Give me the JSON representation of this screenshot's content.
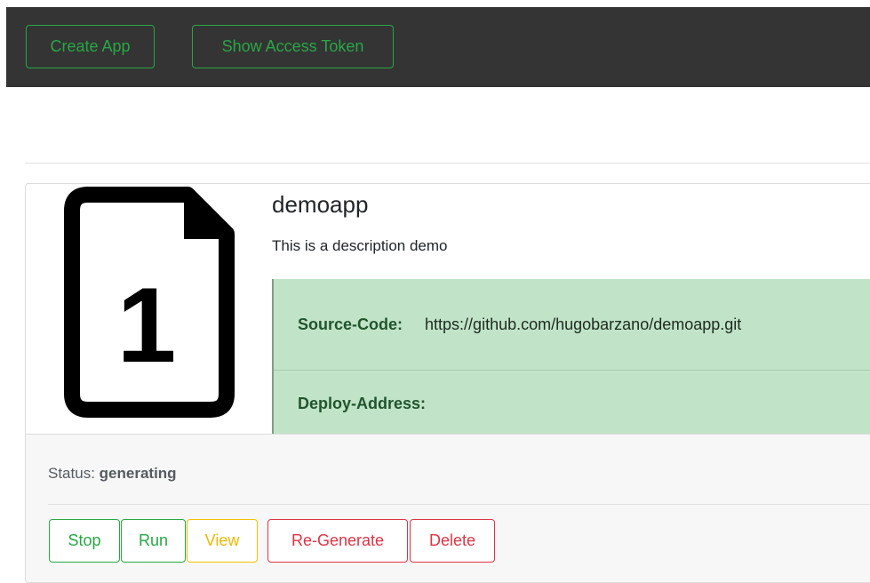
{
  "navbar": {
    "create_app_label": "Create App",
    "show_token_label": "Show Access Token"
  },
  "app": {
    "icon": "file-icon",
    "icon_number": "1",
    "name": "demoapp",
    "description": "This is a description demo",
    "source_code_label": "Source-Code:",
    "source_code_value": "https://github.com/hugobarzano/demoapp.git",
    "deploy_address_label": "Deploy-Address:",
    "deploy_address_value": "",
    "status_label": "Status:",
    "status_value": "generating"
  },
  "actions": {
    "stop_label": "Stop",
    "run_label": "Run",
    "view_label": "View",
    "regenerate_label": "Re-Generate",
    "delete_label": "Delete"
  },
  "colors": {
    "navbar_bg": "#343434",
    "success": "#28a745",
    "warning": "#f2c200",
    "danger": "#dc3545",
    "info_box_bg": "#c1e4c8"
  }
}
